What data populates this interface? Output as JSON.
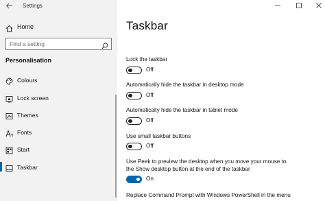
{
  "window": {
    "app_title": "Settings",
    "minimize_icon": "minimize-icon",
    "maximize_icon": "maximize-icon",
    "close_icon": "close-icon"
  },
  "sidebar": {
    "home_label": "Home",
    "search_placeholder": "Find a setting",
    "section_title": "Personalisation",
    "items": [
      {
        "label": "Colours",
        "icon": "palette-icon",
        "active": false
      },
      {
        "label": "Lock screen",
        "icon": "lock-screen-icon",
        "active": false
      },
      {
        "label": "Themes",
        "icon": "themes-icon",
        "active": false
      },
      {
        "label": "Fonts",
        "icon": "fonts-icon",
        "active": false
      },
      {
        "label": "Start",
        "icon": "start-icon",
        "active": false
      },
      {
        "label": "Taskbar",
        "icon": "taskbar-icon",
        "active": true
      }
    ],
    "accent_color": "#0063b1"
  },
  "main": {
    "title": "Taskbar",
    "settings": [
      {
        "label": "Lock the taskbar",
        "state": "Off",
        "on": false
      },
      {
        "label": "Automatically hide the taskbar in desktop mode",
        "state": "Off",
        "on": false
      },
      {
        "label": "Automatically hide the taskbar in tablet mode",
        "state": "Off",
        "on": false
      },
      {
        "label": "Use small taskbar buttons",
        "state": "Off",
        "on": false
      },
      {
        "label_line1": "Use Peek to preview the desktop when you move your mouse to",
        "label_line2": "the Show desktop button at the end of the taskbar",
        "state": "On",
        "on": true
      },
      {
        "label_line1": "Replace Command Prompt with Windows PowerShell in the menu"
      }
    ]
  }
}
